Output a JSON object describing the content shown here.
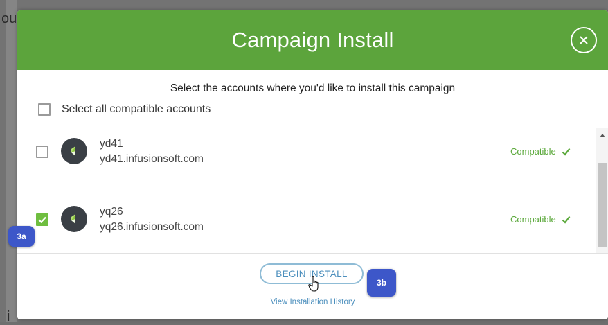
{
  "background": {
    "fragment_top": "ou",
    "fragment_bottom": "i"
  },
  "modal": {
    "title": "Campaign Install",
    "instructions": "Select the accounts where you'd like to install this campaign",
    "select_all_label": "Select all compatible accounts",
    "accent_color": "#5ca43c",
    "accounts": [
      {
        "name": "yd41",
        "domain": "yd41.infusionsoft.com",
        "status": "Compatible",
        "checked": false
      },
      {
        "name": "yq26",
        "domain": "yq26.infusionsoft.com",
        "status": "Compatible",
        "checked": true
      }
    ],
    "begin_install_label": "BEGIN INSTALL",
    "history_link_label": "View Installation History"
  },
  "callouts": {
    "a": "3a",
    "b": "3b"
  },
  "icons": {
    "close": "close-icon",
    "avatar": "infusionsoft-logo-icon",
    "compatible": "check-icon",
    "checkbox_checked": "checkmark-icon",
    "cursor": "hand-pointer-icon",
    "scroll_up": "scroll-up-arrow-icon"
  }
}
